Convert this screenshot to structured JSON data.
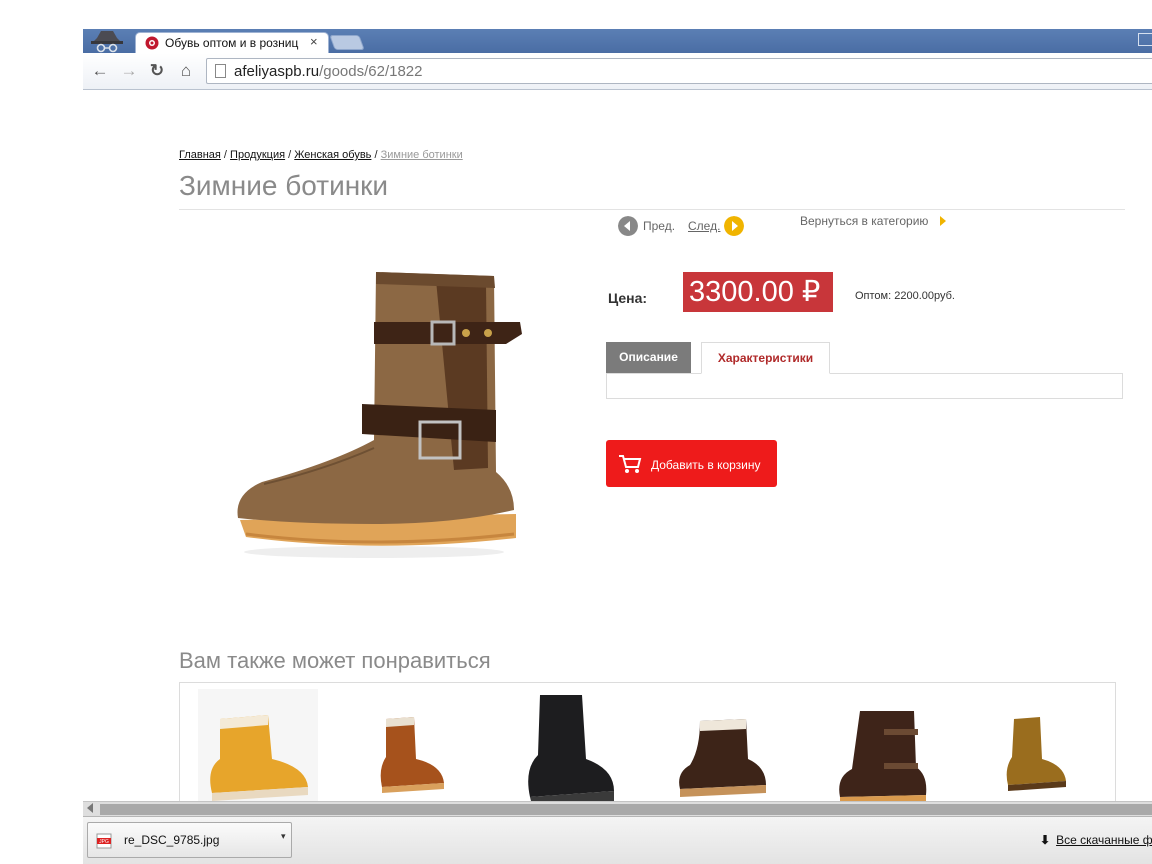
{
  "browser": {
    "tab_title": "Обувь оптом и в розниц",
    "tab_close": "×",
    "url_host": "afeliyaspb.ru",
    "url_path": "/goods/62/1822",
    "nav": {
      "back": "←",
      "forward": "→",
      "reload": "↻",
      "home": "⌂"
    }
  },
  "breadcrumb": {
    "home": "Главная",
    "products": "Продукция",
    "women": "Женская обувь",
    "current": "Зимние ботинки",
    "sep": " / "
  },
  "product": {
    "title": "Зимние ботинки",
    "prev_label": "Пред.",
    "next_label": "След.",
    "back_to_category": "Вернуться в категорию",
    "price_label": "Цена:",
    "price": "3300.00",
    "currency": "₽",
    "wholesale": "Оптом: 2200.00руб.",
    "tabs": {
      "description": "Описание",
      "specs": "Характеристики"
    },
    "add_to_cart": "Добавить в корзину"
  },
  "related": {
    "title": "Вам также может понравиться"
  },
  "downloads": {
    "file_name": "re_DSC_9785.jpg",
    "file_type": "JPG",
    "all_label": "Все скачанные ф"
  },
  "colors": {
    "price_bg": "#c8363a",
    "cart_bg": "#ee1b1b",
    "accent_yellow": "#f0b400",
    "tab_active_text": "#b02a2a"
  }
}
